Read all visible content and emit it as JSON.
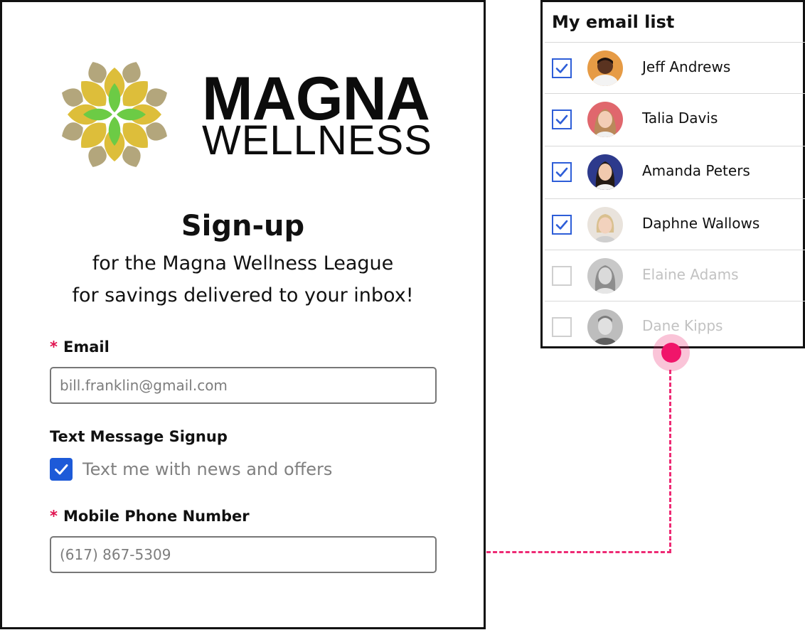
{
  "brand": {
    "name_line1": "MAGNA",
    "name_line2": "WELLNESS",
    "colors": {
      "olive": "#b3a67c",
      "mustard": "#ddbe3a",
      "green": "#6ccb45"
    }
  },
  "signup": {
    "title": "Sign-up",
    "subtitle_line1": "for the Magna Wellness League",
    "subtitle_line2": "for savings delivered to your inbox!",
    "email": {
      "required_mark": "*",
      "label": "Email",
      "placeholder": "bill.franklin@gmail.com"
    },
    "sms": {
      "label": "Text Message Signup",
      "checkbox_label": "Text me with news and offers",
      "checked": true
    },
    "phone": {
      "required_mark": "*",
      "label": "Mobile Phone Number",
      "placeholder": "(617) 867-5309"
    }
  },
  "email_list": {
    "title": "My email list",
    "items": [
      {
        "name": "Jeff Andrews",
        "checked": true
      },
      {
        "name": "Talia Davis",
        "checked": true
      },
      {
        "name": "Amanda Peters",
        "checked": true
      },
      {
        "name": "Daphne Wallows",
        "checked": true
      },
      {
        "name": "Elaine Adams",
        "checked": false
      },
      {
        "name": "Dane Kipps",
        "checked": false
      }
    ]
  },
  "accent_color": "#ee2a74",
  "checkbox_color": "#1d5ad8"
}
